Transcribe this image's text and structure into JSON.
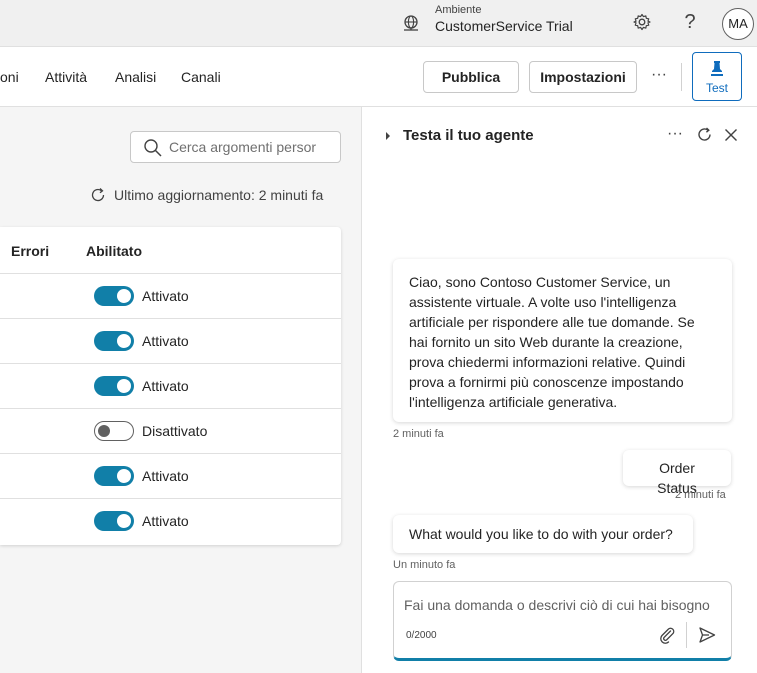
{
  "topbar": {
    "env_label": "Ambiente",
    "env_name": "CustomerService Trial",
    "avatar_initials": "MA",
    "help_glyph": "?"
  },
  "cmdbar": {
    "nav": [
      "oni",
      "Attività",
      "Analisi",
      "Canali"
    ],
    "publish_label": "Pubblica",
    "settings_label": "Impostazioni",
    "more_glyph": "···",
    "test_label": "Test"
  },
  "left": {
    "search_placeholder": "Cerca argomenti persor",
    "updated_text": "Ultimo aggiornamento: 2 minuti fa",
    "columns": {
      "errors": "Errori",
      "enabled": "Abilitato"
    },
    "rows": [
      {
        "state": "on",
        "label": "Attivato"
      },
      {
        "state": "on",
        "label": "Attivato"
      },
      {
        "state": "on",
        "label": "Attivato"
      },
      {
        "state": "off",
        "label": "Disattivato"
      },
      {
        "state": "on",
        "label": "Attivato"
      },
      {
        "state": "on",
        "label": "Attivato"
      }
    ]
  },
  "chat": {
    "title": "Testa il tuo agente",
    "more_glyph": "···",
    "messages": [
      {
        "from": "bot",
        "text": "Ciao, sono Contoso Customer Service, un assistente virtuale. A volte uso l'intelligenza artificiale per rispondere alle tue domande. Se hai fornito un sito Web durante la creazione, prova chiedermi informazioni relative. Quindi prova a fornirmi più conoscenze impostando l'intelligenza artificiale generativa.",
        "time": "2 minuti fa"
      },
      {
        "from": "user",
        "text": "Order Status",
        "time": "2 minuti fa"
      },
      {
        "from": "bot",
        "text": "What would you like to do with your order?",
        "time": "Un minuto fa"
      }
    ],
    "input_placeholder": "Fai una domanda o descrivi ciò di cui hai bisogno",
    "counter": "0/2000"
  },
  "colors": {
    "accent": "#117fa8",
    "primary_blue": "#0f6cbd"
  }
}
